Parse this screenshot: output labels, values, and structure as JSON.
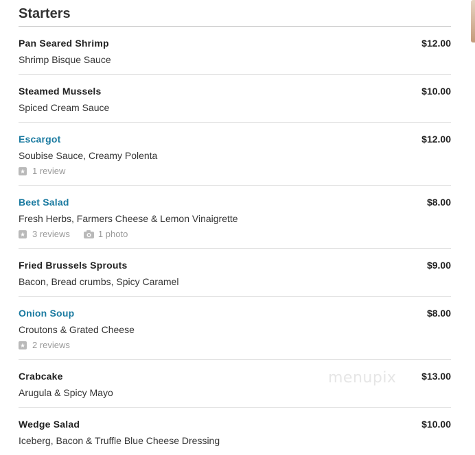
{
  "section": {
    "title": "Starters"
  },
  "items": [
    {
      "name": "Pan Seared Shrimp",
      "price": "$12.00",
      "desc": "Shrimp Bisque Sauce",
      "link": false
    },
    {
      "name": "Steamed Mussels",
      "price": "$10.00",
      "desc": "Spiced Cream Sauce",
      "link": false
    },
    {
      "name": "Escargot",
      "price": "$12.00",
      "desc": "Soubise Sauce, Creamy Polenta",
      "link": true,
      "reviews": "1 review"
    },
    {
      "name": "Beet Salad",
      "price": "$8.00",
      "desc": "Fresh Herbs, Farmers Cheese & Lemon Vinaigrette",
      "link": true,
      "reviews": "3 reviews",
      "photos": "1 photo"
    },
    {
      "name": "Fried Brussels Sprouts",
      "price": "$9.00",
      "desc": "Bacon, Bread crumbs, Spicy Caramel",
      "link": false
    },
    {
      "name": "Onion Soup",
      "price": "$8.00",
      "desc": "Croutons & Grated Cheese",
      "link": true,
      "reviews": "2 reviews"
    },
    {
      "name": "Crabcake",
      "price": "$13.00",
      "desc": "Arugula & Spicy Mayo",
      "link": false
    },
    {
      "name": "Wedge Salad",
      "price": "$10.00",
      "desc": "Iceberg, Bacon & Truffle Blue Cheese Dressing",
      "link": false
    }
  ],
  "watermark": "menupix",
  "icons": {
    "review": "star-icon",
    "photo": "camera-icon"
  },
  "colors": {
    "link": "#1a7aa0",
    "meta": "#999999"
  }
}
